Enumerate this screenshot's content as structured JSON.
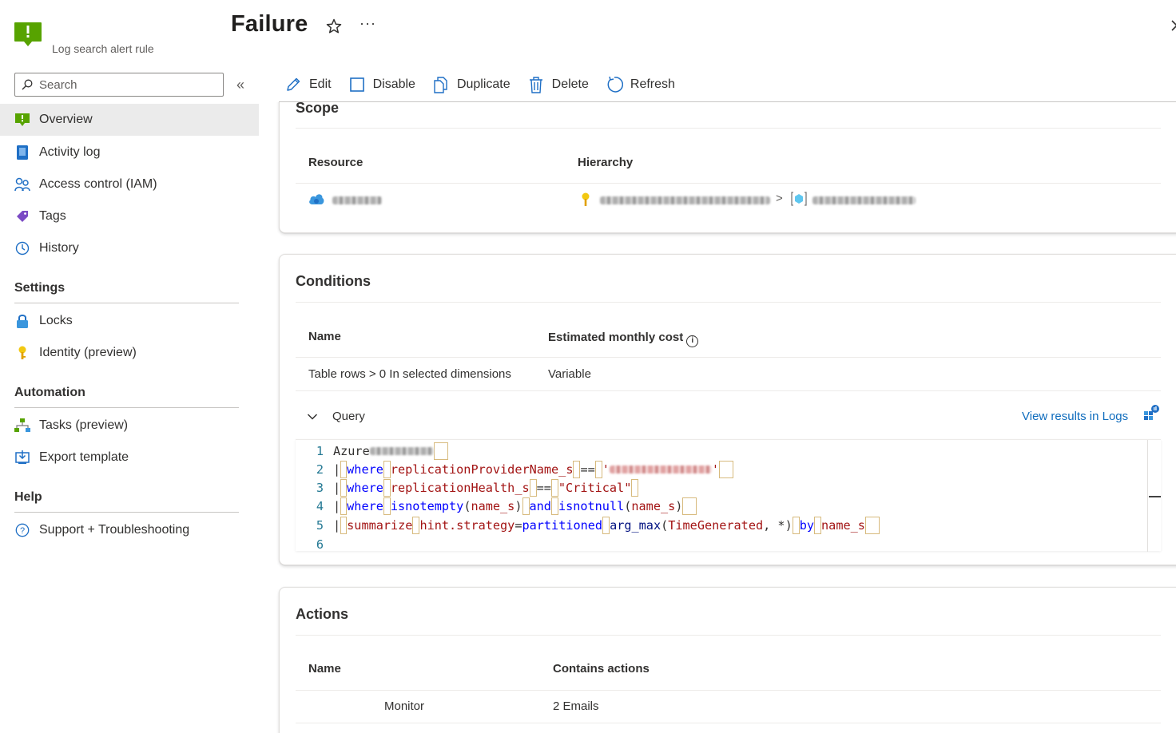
{
  "header": {
    "title": "Failure",
    "resource_type": "Log search alert rule",
    "more_label": "···"
  },
  "colors": {
    "accent": "#0f6cbd",
    "alert_green": "#57a300",
    "link": "#0f6cbd"
  },
  "sidebar": {
    "search_placeholder": "Search",
    "collapse_label": "«",
    "items": [
      {
        "label": "Overview",
        "icon": "alert-rule-icon"
      },
      {
        "label": "Activity log",
        "icon": "activity-log-icon"
      },
      {
        "label": "Access control (IAM)",
        "icon": "iam-icon"
      },
      {
        "label": "Tags",
        "icon": "tag-icon"
      },
      {
        "label": "History",
        "icon": "clock-icon"
      }
    ],
    "sections": [
      {
        "title": "Settings",
        "items": [
          {
            "label": "Locks",
            "icon": "lock-icon"
          },
          {
            "label": "Identity (preview)",
            "icon": "key-icon"
          }
        ]
      },
      {
        "title": "Automation",
        "items": [
          {
            "label": "Tasks (preview)",
            "icon": "tasks-icon"
          },
          {
            "label": "Export template",
            "icon": "export-icon"
          }
        ]
      },
      {
        "title": "Help",
        "items": [
          {
            "label": "Support + Troubleshooting",
            "icon": "support-icon"
          }
        ]
      }
    ]
  },
  "toolbar": {
    "edit": "Edit",
    "disable": "Disable",
    "duplicate": "Duplicate",
    "delete": "Delete",
    "refresh": "Refresh"
  },
  "scope": {
    "title": "Scope",
    "columns": [
      "Resource",
      "Hierarchy"
    ],
    "separator": ">"
  },
  "conditions": {
    "title": "Conditions",
    "columns": [
      "Name",
      "Estimated monthly cost"
    ],
    "info_glyph": "i",
    "row": {
      "name": "Table rows > 0 In selected dimensions",
      "cost": "Variable"
    },
    "query_label": "Query",
    "view_results": "View results in Logs",
    "code": {
      "line_numbers": [
        "1",
        "2",
        "3",
        "4",
        "5",
        "6"
      ],
      "l1_start": "Azure",
      "pipe": "|",
      "where": "where",
      "l2_col": "replicationProviderName_s",
      "eq": "==",
      "l3_col": "replicationHealth_s",
      "l3_str": "\"Critical\"",
      "l4_fn1": "isnotempty",
      "l4_arg": "name_s",
      "and": "and",
      "l4_fn2": "isnotnull",
      "summarize": "summarize",
      "hint": "hint.strategy",
      "partitioned": "partitioned",
      "arg_max": "arg_max",
      "timegen": "TimeGenerated",
      "star": "*",
      "by": "by",
      "l5_by_col": "name_s"
    }
  },
  "actions": {
    "title": "Actions",
    "columns": [
      "Name",
      "Contains actions"
    ],
    "row": {
      "name": "Monitor",
      "contains": "2 Emails"
    }
  }
}
